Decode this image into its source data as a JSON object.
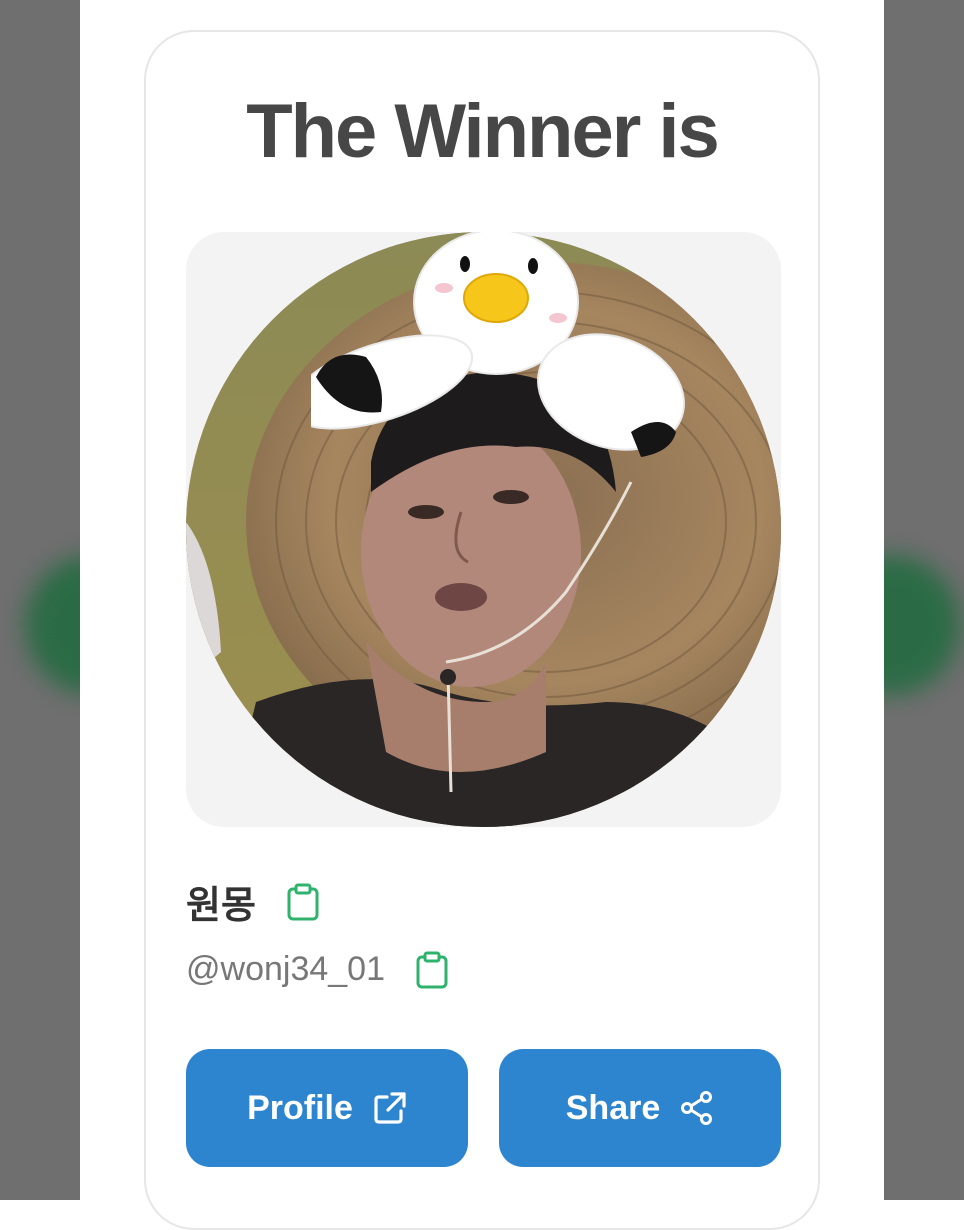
{
  "card": {
    "title": "The Winner is"
  },
  "winner": {
    "name": "원몽",
    "handle": "@wonj34_01",
    "copy_name_icon": "clipboard-icon",
    "copy_handle_icon": "clipboard-icon"
  },
  "actions": {
    "profile_label": "Profile",
    "profile_icon": "external-link-icon",
    "share_label": "Share",
    "share_icon": "share-icon"
  },
  "colors": {
    "button_blue": "#2d84cf",
    "title_text": "#474747",
    "clipboard_green": "#2fb36c",
    "card_border": "#e6e6e6"
  }
}
